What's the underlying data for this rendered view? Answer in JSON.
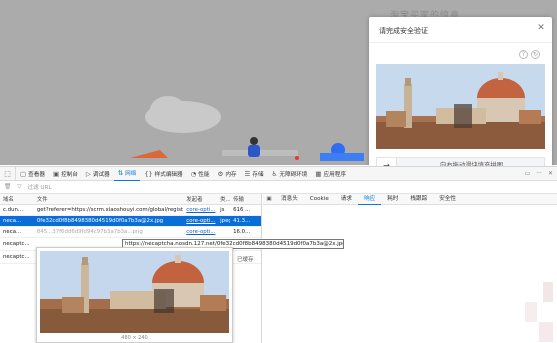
{
  "page": {
    "title": "淘宝买家的惊喜"
  },
  "captcha": {
    "title": "请完成安全验证",
    "close_icon": "close-icon",
    "tools": [
      "?",
      "↻"
    ],
    "slider_arrow": "→",
    "slider_hint": "向右拖动滑块填充拼图"
  },
  "devtools": {
    "tabs": [
      {
        "icon": "▢",
        "label": "查看器"
      },
      {
        "icon": "▣",
        "label": "控制台"
      },
      {
        "icon": "▷",
        "label": "调试器"
      },
      {
        "icon": "⇅",
        "label": "网络"
      },
      {
        "icon": "{}",
        "label": "样式编辑器"
      },
      {
        "icon": "◔",
        "label": "性能"
      },
      {
        "icon": "⚙",
        "label": "内存"
      },
      {
        "icon": "☰",
        "label": "存储"
      },
      {
        "icon": "♿",
        "label": "无障碍环境"
      },
      {
        "icon": "▦",
        "label": "应用程序"
      }
    ],
    "active_tab": "网络",
    "filter": {
      "trash_icon": "trash-icon",
      "filter_icon": "filter-icon",
      "placeholder": "过滤 URL"
    },
    "table": {
      "headers": [
        "域名",
        "文件",
        "发起者",
        "类...",
        "传输"
      ],
      "rows": [
        {
          "name": "c.dun...",
          "file": "get?referer=https://scrm.xiaoshouyi.com/global/register.ac",
          "initiator": "core-opti...",
          "type": "js",
          "size": "616 ..."
        },
        {
          "name": "neca...",
          "file": "0fe32cd0f8b8498380d4519d0f0a7b3a@2x.jpg",
          "initiator": "core-opti...",
          "type": "jpeg",
          "size": "41.3..."
        },
        {
          "name": "neca...",
          "file": "845...37f6dd6d9fd94c97b3a7b3a...png",
          "initiator": "core-opti...",
          "type": "",
          "size": "16.0..."
        },
        {
          "name": "necaptc...",
          "file": "",
          "initiator": "",
          "type": "",
          "size": ""
        },
        {
          "name": "necaptc...",
          "file": "",
          "initiator": "",
          "type": "",
          "size": ""
        }
      ]
    },
    "tooltip_url": "https://necaptcha.nosdn.127.net/0fe32cd0f8b8498380d4519d0f0a7b3a@2x.jpg",
    "preview_dimensions": "480 × 240",
    "detail_tabs": [
      "消息头",
      "Cookie",
      "请求",
      "响应",
      "耗时",
      "栈跟踪",
      "安全性"
    ],
    "active_detail_tab": "响应",
    "cached_label": "已缓存"
  },
  "colors": {
    "accent": "#0a78d4",
    "selected_row": "#0a6ed8",
    "overlay": "#ababab"
  }
}
